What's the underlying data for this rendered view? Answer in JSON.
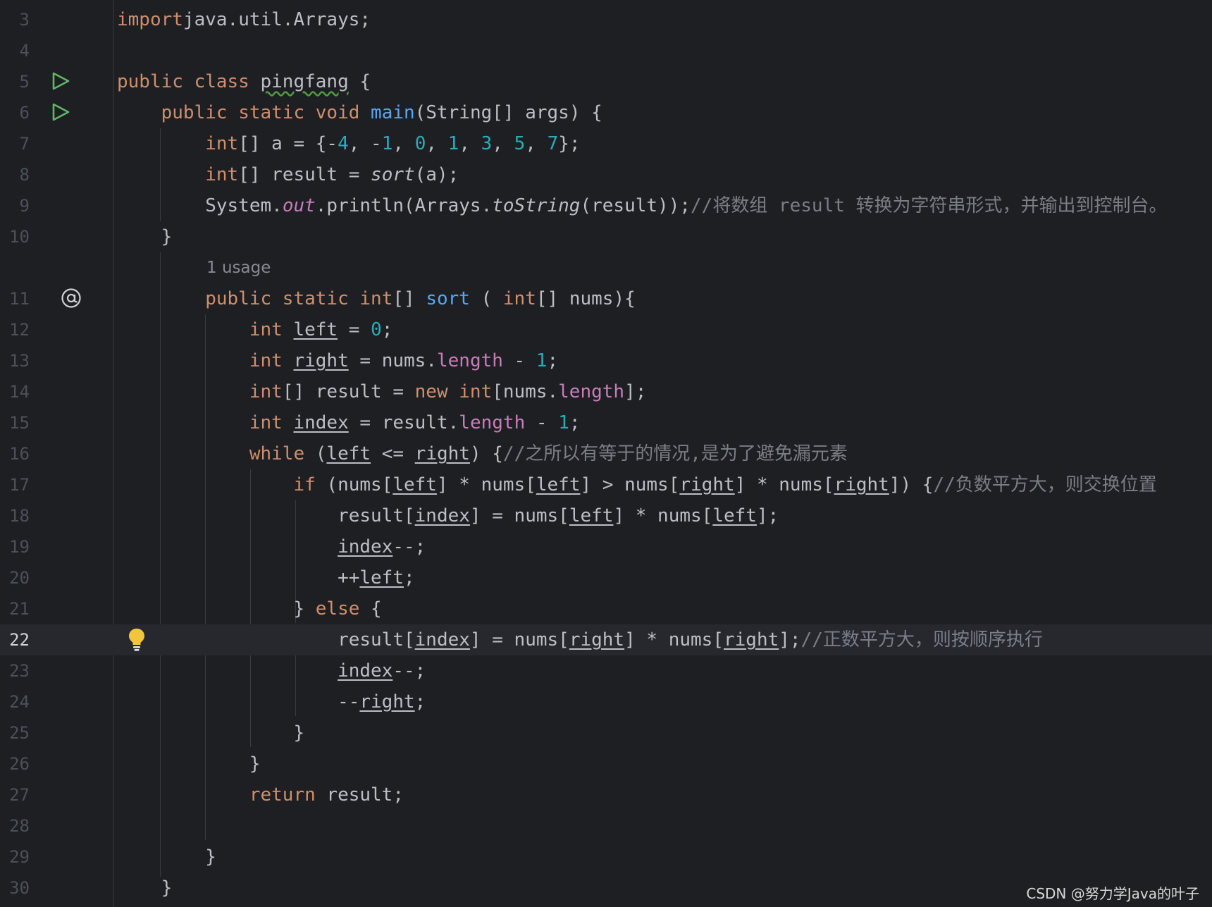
{
  "watermark": "CSDN @努力学Java的叶子",
  "inlay_hint": "1 usage",
  "lines": [
    {
      "no": "3",
      "parts": [
        [
          "k",
          "import"
        ],
        [
          "",
          "java.util.Arrays;"
        ]
      ]
    },
    {
      "no": "4",
      "parts": []
    },
    {
      "no": "5",
      "parts": [
        [
          "k",
          "public class "
        ],
        [
          "w",
          "pingfang"
        ],
        [
          "",
          " {"
        ]
      ]
    },
    {
      "no": "6",
      "parts": [
        [
          "",
          "    "
        ],
        [
          "k",
          "public static void "
        ],
        [
          "f",
          "main"
        ],
        [
          "",
          "(String[] args) {"
        ]
      ]
    },
    {
      "no": "7",
      "parts": [
        [
          "",
          "        "
        ],
        [
          "k",
          "int"
        ],
        [
          "",
          "[] a = {-"
        ],
        [
          "n",
          "4"
        ],
        [
          "",
          ", -"
        ],
        [
          "n",
          "1"
        ],
        [
          "",
          ", "
        ],
        [
          "n",
          "0"
        ],
        [
          "",
          ", "
        ],
        [
          "n",
          "1"
        ],
        [
          "",
          ", "
        ],
        [
          "n",
          "3"
        ],
        [
          "",
          ", "
        ],
        [
          "n",
          "5"
        ],
        [
          "",
          ", "
        ],
        [
          "n",
          "7"
        ],
        [
          "",
          "};"
        ]
      ]
    },
    {
      "no": "8",
      "parts": [
        [
          "",
          "        "
        ],
        [
          "k",
          "int"
        ],
        [
          "",
          "[] result = "
        ],
        [
          "i",
          "sort"
        ],
        [
          "",
          "(a);"
        ]
      ]
    },
    {
      "no": "9",
      "parts": [
        [
          "",
          "        System."
        ],
        [
          "mi",
          "out"
        ],
        [
          "",
          ".println(Arrays."
        ],
        [
          "i",
          "toString"
        ],
        [
          "",
          "(result));"
        ],
        [
          "c",
          "//将数组 result 转换为字符串形式，并输出到控制台。"
        ]
      ]
    },
    {
      "no": "10",
      "parts": [
        [
          "",
          "    }"
        ]
      ]
    },
    {
      "no": "11",
      "parts": [
        [
          "",
          "        "
        ],
        [
          "k",
          "public static int"
        ],
        [
          "",
          "[] "
        ],
        [
          "f",
          "sort"
        ],
        [
          "",
          " ( "
        ],
        [
          "k",
          "int"
        ],
        [
          "",
          "[] nums){"
        ]
      ]
    },
    {
      "no": "12",
      "parts": [
        [
          "",
          "            "
        ],
        [
          "k",
          "int "
        ],
        [
          "u",
          "left"
        ],
        [
          "",
          " = "
        ],
        [
          "n",
          "0"
        ],
        [
          "",
          ";"
        ]
      ]
    },
    {
      "no": "13",
      "parts": [
        [
          "",
          "            "
        ],
        [
          "k",
          "int "
        ],
        [
          "u",
          "right"
        ],
        [
          "",
          " = nums."
        ],
        [
          "m",
          "length"
        ],
        [
          "",
          " - "
        ],
        [
          "n",
          "1"
        ],
        [
          "",
          ";"
        ]
      ]
    },
    {
      "no": "14",
      "parts": [
        [
          "",
          "            "
        ],
        [
          "k",
          "int"
        ],
        [
          "",
          "[] result = "
        ],
        [
          "k",
          "new int"
        ],
        [
          "",
          "[nums."
        ],
        [
          "m",
          "length"
        ],
        [
          "",
          "];"
        ]
      ]
    },
    {
      "no": "15",
      "parts": [
        [
          "",
          "            "
        ],
        [
          "k",
          "int "
        ],
        [
          "u",
          "index"
        ],
        [
          "",
          " = result."
        ],
        [
          "m",
          "length"
        ],
        [
          "",
          " - "
        ],
        [
          "n",
          "1"
        ],
        [
          "",
          ";"
        ]
      ]
    },
    {
      "no": "16",
      "parts": [
        [
          "",
          "            "
        ],
        [
          "k",
          "while "
        ],
        [
          "",
          "("
        ],
        [
          "u",
          "left"
        ],
        [
          "",
          " <= "
        ],
        [
          "u",
          "right"
        ],
        [
          "",
          ") {"
        ],
        [
          "c",
          "//之所以有等于的情况,是为了避免漏元素"
        ]
      ]
    },
    {
      "no": "17",
      "parts": [
        [
          "",
          "                "
        ],
        [
          "k",
          "if "
        ],
        [
          "",
          "(nums["
        ],
        [
          "u",
          "left"
        ],
        [
          "",
          "] * nums["
        ],
        [
          "u",
          "left"
        ],
        [
          "",
          "] > nums["
        ],
        [
          "u",
          "right"
        ],
        [
          "",
          "] * nums["
        ],
        [
          "u",
          "right"
        ],
        [
          "",
          "]) {"
        ],
        [
          "c",
          "//负数平方大，则交换位置"
        ]
      ]
    },
    {
      "no": "18",
      "parts": [
        [
          "",
          "                    result["
        ],
        [
          "u",
          "index"
        ],
        [
          "",
          "] = nums["
        ],
        [
          "u",
          "left"
        ],
        [
          "",
          "] * nums["
        ],
        [
          "u",
          "left"
        ],
        [
          "",
          "];"
        ]
      ]
    },
    {
      "no": "19",
      "parts": [
        [
          "",
          "                    "
        ],
        [
          "u",
          "index"
        ],
        [
          "",
          "--;"
        ]
      ]
    },
    {
      "no": "20",
      "parts": [
        [
          "",
          "                    ++"
        ],
        [
          "u",
          "left"
        ],
        [
          "",
          ";"
        ]
      ]
    },
    {
      "no": "21",
      "parts": [
        [
          "",
          "                } "
        ],
        [
          "k",
          "else"
        ],
        [
          "",
          " {"
        ]
      ]
    },
    {
      "no": "22",
      "parts": [
        [
          "",
          "                    result["
        ],
        [
          "u",
          "index"
        ],
        [
          "",
          "] = nums["
        ],
        [
          "u",
          "right"
        ],
        [
          "",
          "] * nums["
        ],
        [
          "u",
          "right"
        ],
        [
          "",
          "];"
        ],
        [
          "c",
          "//正数平方大，则按顺序执行"
        ]
      ]
    },
    {
      "no": "23",
      "parts": [
        [
          "",
          "                    "
        ],
        [
          "u",
          "index"
        ],
        [
          "",
          "--;"
        ]
      ]
    },
    {
      "no": "24",
      "parts": [
        [
          "",
          "                    --"
        ],
        [
          "u",
          "right"
        ],
        [
          "",
          ";"
        ]
      ]
    },
    {
      "no": "25",
      "parts": [
        [
          "",
          "                }"
        ]
      ]
    },
    {
      "no": "26",
      "parts": [
        [
          "",
          "            }"
        ]
      ]
    },
    {
      "no": "27",
      "parts": [
        [
          "",
          "            "
        ],
        [
          "k",
          "return"
        ],
        [
          "",
          " result;"
        ]
      ]
    },
    {
      "no": "28",
      "parts": []
    },
    {
      "no": "29",
      "parts": [
        [
          "",
          "        }"
        ]
      ]
    },
    {
      "no": "30",
      "parts": [
        [
          "",
          "    }"
        ]
      ]
    }
  ]
}
